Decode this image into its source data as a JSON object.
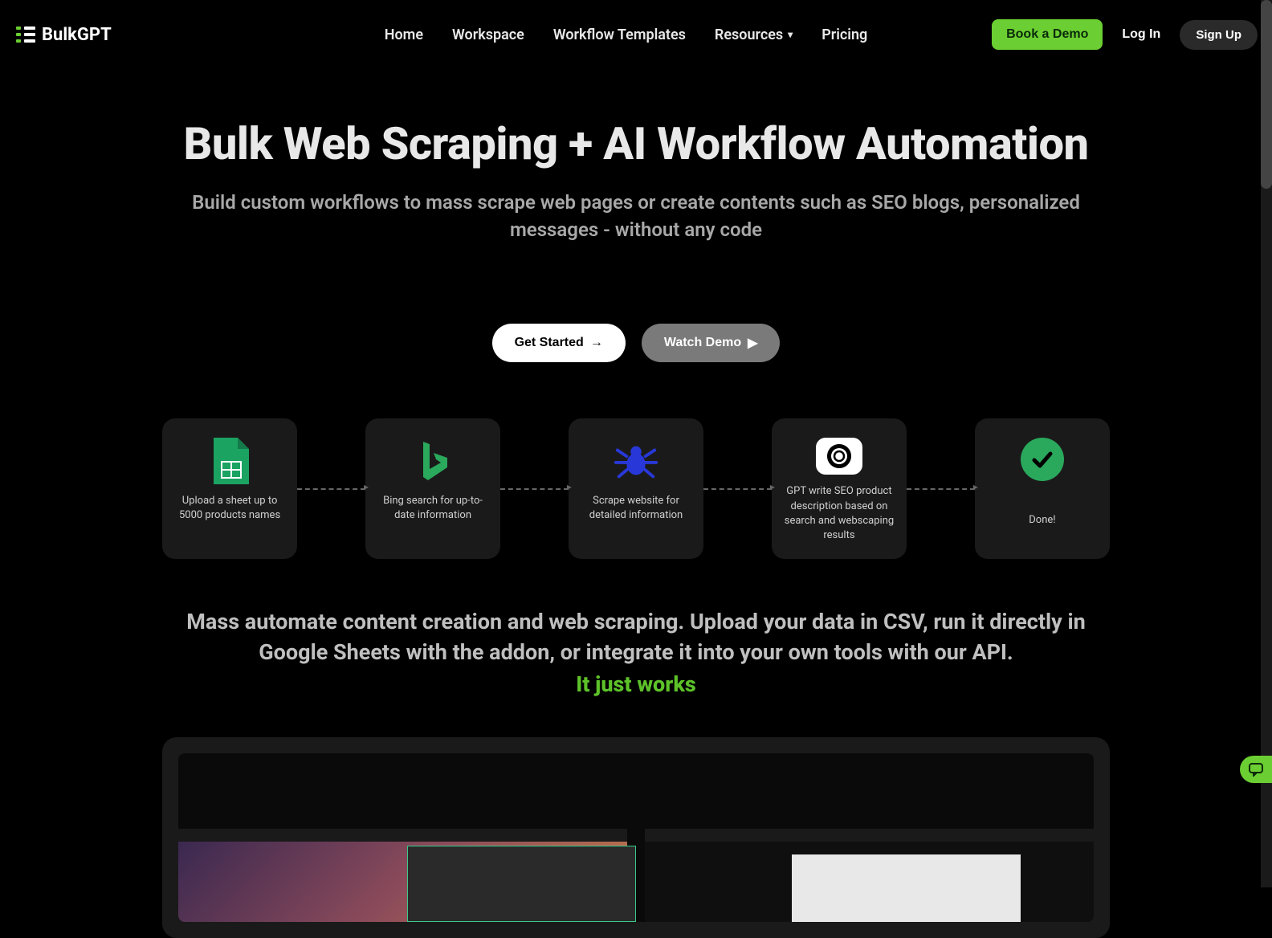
{
  "brand": {
    "name": "BulkGPT"
  },
  "nav": {
    "items": [
      {
        "label": "Home"
      },
      {
        "label": "Workspace"
      },
      {
        "label": "Workflow Templates"
      },
      {
        "label": "Resources"
      },
      {
        "label": "Pricing"
      }
    ]
  },
  "actions": {
    "book_demo": "Book a Demo",
    "login": "Log In",
    "signup": "Sign Up"
  },
  "hero": {
    "title": "Bulk Web Scraping + AI Workflow Automation",
    "subtitle": "Build custom workflows to mass scrape web pages or create contents such as SEO blogs, personalized messages - without any code",
    "get_started": "Get Started",
    "watch_demo": "Watch Demo"
  },
  "steps": [
    {
      "icon": "sheet",
      "text": "Upload a sheet up to 5000 products names"
    },
    {
      "icon": "bing",
      "text": "Bing search for up-to-date information"
    },
    {
      "icon": "spider",
      "text": "Scrape website for detailed information"
    },
    {
      "icon": "openai",
      "text": "GPT write SEO product description based on search and webscaping results"
    },
    {
      "icon": "check",
      "text": "Done!"
    }
  ],
  "secondary": {
    "text": "Mass automate content creation and web scraping. Upload your data in CSV, run it directly in Google Sheets with the addon, or integrate it into your own tools with our API.",
    "highlight": "It just works"
  },
  "colors": {
    "accent_green": "#6bce32",
    "highlight_green": "#5dc229"
  }
}
